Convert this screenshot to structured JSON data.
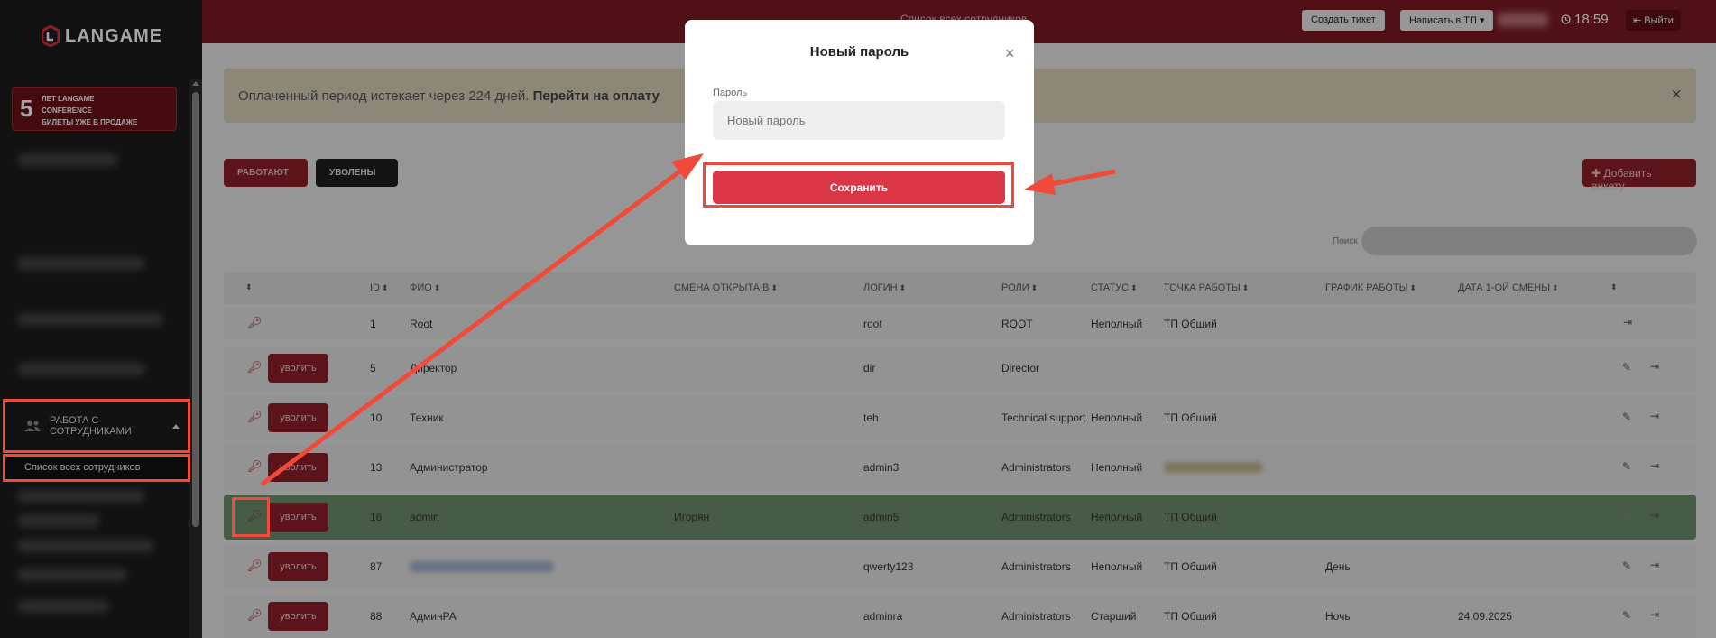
{
  "sidebar": {
    "logo_text": "LANGAME",
    "promo": {
      "number": "5",
      "line1": "ЛЕТ LANGAME",
      "line2": "CONFERENCE",
      "line3": "БИЛЕТЫ УЖЕ В ПРОДАЖЕ"
    },
    "section_label": "РАБОТА С СОТРУДНИКАМИ",
    "sub_item_label": "Список всех сотрудников"
  },
  "header": {
    "title": "Список всех сотрудников",
    "create_ticket": "Создать тикет",
    "write_support": "Написать в ТП",
    "time": "18:59",
    "logout": "Выйти"
  },
  "banner": {
    "text": "Оплаченный период истекает через 224 дней.",
    "link": "Перейти на оплату",
    "close": "×"
  },
  "tabs": {
    "working": "РАБОТАЮТ",
    "fired": "УВОЛЕНЫ"
  },
  "add_button": "Добавить анкету",
  "search_label": "Поиск",
  "table": {
    "headers": [
      "ID",
      "ФИО",
      "СМЕНА ОТКРЫТА В",
      "ЛОГИН",
      "РОЛИ",
      "СТАТУС",
      "ТОЧКА РАБОТЫ",
      "ГРАФИК РАБОТЫ",
      "ДАТА 1-ОЙ СМЕНЫ"
    ],
    "fire_label": "уволить",
    "rows": [
      {
        "id": "1",
        "name": "Root",
        "shift": "",
        "login": "root",
        "role": "ROOT",
        "status": "Неполный",
        "point": "ТП Общий",
        "schedule": "",
        "date": ""
      },
      {
        "id": "5",
        "name": "Директор",
        "shift": "",
        "login": "dir",
        "role": "Director",
        "status": "",
        "point": "",
        "schedule": "",
        "date": ""
      },
      {
        "id": "10",
        "name": "Техник",
        "shift": "",
        "login": "teh",
        "role": "Technical support",
        "status": "Неполный",
        "point": "ТП Общий",
        "schedule": "",
        "date": ""
      },
      {
        "id": "13",
        "name": "Администратор",
        "shift": "",
        "login": "admin3",
        "role": "Administrators",
        "status": "Неполный",
        "point": "",
        "schedule": "",
        "date": ""
      },
      {
        "id": "16",
        "name": "admin",
        "shift": "Игорян",
        "login": "admin5",
        "role": "Administrators",
        "status": "Неполный",
        "point": "ТП Общий",
        "schedule": "",
        "date": ""
      },
      {
        "id": "87",
        "name": "",
        "shift": "",
        "login": "qwerty123",
        "role": "Administrators",
        "status": "Неполный",
        "point": "ТП Общий",
        "schedule": "День",
        "date": ""
      },
      {
        "id": "88",
        "name": "АдминРА",
        "shift": "",
        "login": "adminra",
        "role": "Administrators",
        "status": "Старший",
        "point": "ТП Общий",
        "schedule": "Ночь",
        "date": "24.09.2025"
      }
    ]
  },
  "modal": {
    "title": "Новый пароль",
    "field_label": "Пароль",
    "field_placeholder": "Новый пароль",
    "save_label": "Сохранить",
    "close": "×"
  },
  "colors": {
    "accent": "#db3645",
    "highlight": "#f04a3a",
    "sidebar": "#1d1d1d",
    "header": "#7a1a22"
  }
}
